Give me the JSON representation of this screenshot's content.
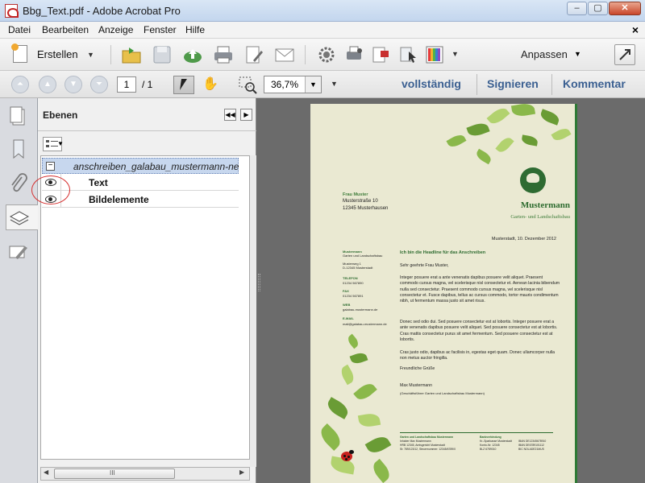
{
  "window": {
    "title": "Bbg_Text.pdf - Adobe Acrobat Pro",
    "min_glyph": "–",
    "max_glyph": "▢",
    "close_glyph": "✕"
  },
  "menu": {
    "items": [
      "Datei",
      "Bearbeiten",
      "Anzeige",
      "Fenster",
      "Hilfe"
    ],
    "close_glyph": "×"
  },
  "toolbar": {
    "create_label": "Erstellen",
    "customize_label": "Anpassen"
  },
  "nav": {
    "page_number": "1",
    "page_total": "/ 1",
    "zoom": "36,7%",
    "links": [
      "vollständig",
      "Signieren",
      "Kommentar"
    ]
  },
  "layers_panel": {
    "title": "Ebenen",
    "root_layer": "anschreiben_galabau_mustermann-ne",
    "layers": [
      {
        "name": "Text",
        "visible": true
      },
      {
        "name": "Bildelemente",
        "visible": true
      }
    ],
    "scroll_left": "◀",
    "scroll_right": "▶",
    "scroll_grip": "III"
  },
  "document": {
    "company_name": "Mustermann",
    "company_subtitle": "Garten- und Landschaftsbau",
    "recipient": [
      "Frau Muster",
      "Musterstraße 10",
      "12345 Musterhausen"
    ],
    "date_line": "Musterstadt, 10. Dezember 2012",
    "sidebar": {
      "company": "Mustermann",
      "company_sub": "Garten und Landschaftsbau",
      "street": "Musterweg 1",
      "city": "D-12345 Musterstadt",
      "tel_label": "TELEFON",
      "tel": "01234 567890",
      "fax_label": "FAX",
      "fax": "01234 567891",
      "web_label": "WEB",
      "web": "galabau-mustermann.de",
      "mail_label": "E-MAIL",
      "mail": "mail@galabau-mustermann.de"
    },
    "headline": "Ich bin die Headline für das Anschreiben",
    "salutation": "Sehr geehrte Frau Muster,",
    "paragraph1": "Integer posuere erat a ante venenatis dapibus posuere velit aliquet. Praesent commodo cursus magna, vel scelerisque nisl consectetur et. Aenean lacinia bibendum nulla sed consectetur. Praesent commodo cursus magna, vel scelerisque nisl consectetur et. Fusce dapibus, tellus ac cursus commodo, tortor mauris condimentum nibh, ut fermentum massa justo sit amet risus.",
    "paragraph2": "Donec sed odio dui. Sed posuere consectetur est at lobortis. Integer posuere erat a ante venenatis dapibus posuere velit aliquet. Sed posuere consectetur est at lobortis. Cras mattis consectetur purus sit amet fermentum. Sed posuere consectetur est at lobortis.",
    "paragraph3": "Cras justo odio, dapibus ac facilisis in, egestas eget quam. Donec ullamcorper nulla non metus auctor fringilla.",
    "closing": "Freundliche Grüße",
    "signer": "Max Mustermann",
    "signer_title": "(Geschäftsführer Garten und Landschaftsbau Mustermann)",
    "footer": {
      "col1_title": "Garten und Landschaftsbau Mustermann",
      "col1_lines": [
        "Inhaber Max Mustermann",
        "HRB 12345, Amtsgericht Musterstadt",
        "St: 789/123/12, Steuernummer: 12345/6789/0"
      ],
      "col2_title": "Bankverbindung",
      "col2_lines": [
        "Kr.-Sparkasse Musterstadt",
        "Konto-Nr. 12345",
        "BLZ 6789010"
      ],
      "col3_lines": [
        "IBAN DE12345678910",
        "IBAN DE6789101112",
        "BIC NOLADE21MUS"
      ]
    }
  }
}
